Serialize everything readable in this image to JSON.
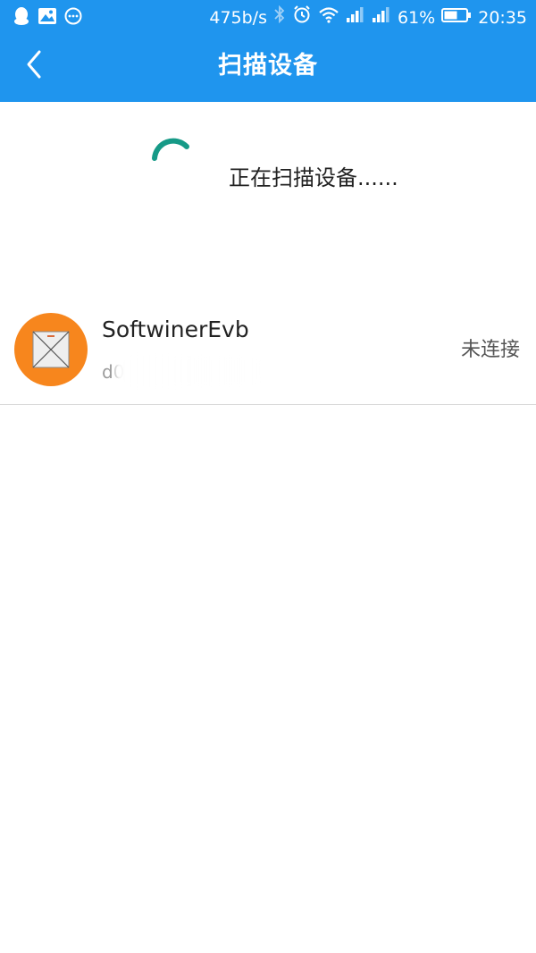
{
  "status_bar": {
    "left_icons": [
      "qq-icon",
      "gallery-icon",
      "chat-icon"
    ],
    "network_speed": "475b/s",
    "battery_percent": "61%",
    "time": "20:35",
    "icons": [
      "bluetooth-icon",
      "alarm-icon",
      "wifi-icon",
      "signal-icon",
      "signal-icon",
      "battery-icon"
    ]
  },
  "header": {
    "title": "扫描设备",
    "back_icon": "chevron-left-icon"
  },
  "scanning": {
    "status_text": "正在扫描设备......"
  },
  "devices": [
    {
      "name": "SoftwinerEvb",
      "mac_visible": "d0",
      "connection_status": "未连接",
      "avatar_icon": "device-icon"
    }
  ],
  "colors": {
    "header_bg": "#1f95ee",
    "spinner": "#169a87",
    "avatar_bg": "#f7861d"
  }
}
